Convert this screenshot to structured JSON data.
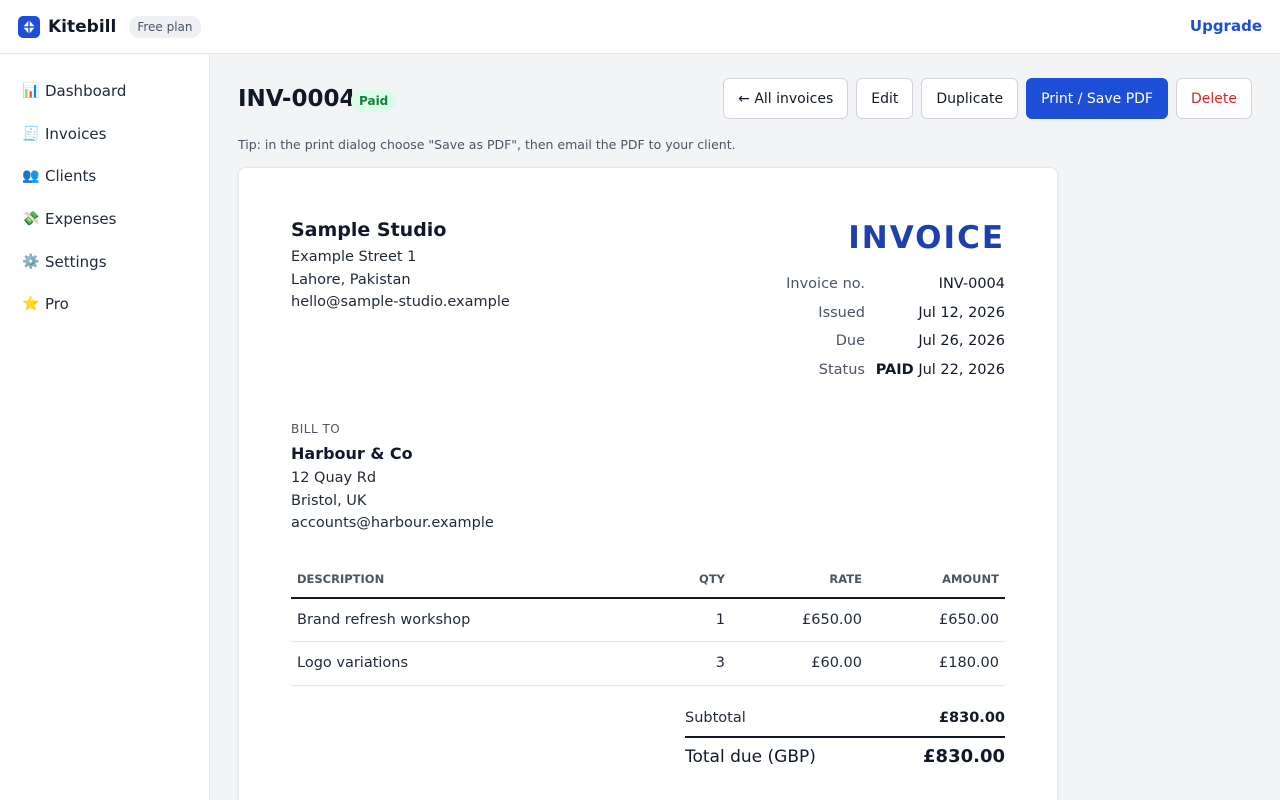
{
  "app": {
    "name": "Kitebill",
    "plan_badge": "Free plan",
    "upgrade_label": "Upgrade",
    "accent_color": "#1d4ed8"
  },
  "sidebar": {
    "items": [
      {
        "icon": "📊",
        "icon_name": "bar-chart-icon",
        "label": "Dashboard"
      },
      {
        "icon": "🧾",
        "icon_name": "receipt-icon",
        "label": "Invoices"
      },
      {
        "icon": "👥",
        "icon_name": "people-icon",
        "label": "Clients"
      },
      {
        "icon": "💸",
        "icon_name": "money-icon",
        "label": "Expenses"
      },
      {
        "icon": "⚙️",
        "icon_name": "gear-icon",
        "label": "Settings"
      },
      {
        "icon": "⭐",
        "icon_name": "star-icon",
        "label": "Pro"
      }
    ]
  },
  "header": {
    "invoice_id": "INV-0004",
    "status_badge": "Paid",
    "tip": "Tip: in the print dialog choose \"Save as PDF\", then email the PDF to your client.",
    "actions": {
      "all_invoices": "← All invoices",
      "edit": "Edit",
      "duplicate": "Duplicate",
      "print": "Print / Save PDF",
      "delete": "Delete"
    }
  },
  "invoice": {
    "from": {
      "name": "Sample Studio",
      "street": "Example Street 1",
      "city": "Lahore, Pakistan",
      "email": "hello@sample-studio.example"
    },
    "heading": "INVOICE",
    "meta": {
      "number_label": "Invoice no.",
      "number": "INV-0004",
      "issued_label": "Issued",
      "issued": "Jul 12, 2026",
      "due_label": "Due",
      "due": "Jul 26, 2026",
      "status_label": "Status",
      "status_word": "PAID",
      "status_date": "Jul 22, 2026"
    },
    "bill_to": {
      "label": "BILL TO",
      "name": "Harbour & Co",
      "street": "12 Quay Rd",
      "city": "Bristol, UK",
      "email": "accounts@harbour.example"
    },
    "columns": {
      "description": "DESCRIPTION",
      "qty": "QTY",
      "rate": "RATE",
      "amount": "AMOUNT"
    },
    "line_items": [
      {
        "description": "Brand refresh workshop",
        "qty": "1",
        "rate": "£650.00",
        "amount": "£650.00"
      },
      {
        "description": "Logo variations",
        "qty": "3",
        "rate": "£60.00",
        "amount": "£180.00"
      }
    ],
    "subtotal_label": "Subtotal",
    "subtotal": "£830.00",
    "total_label": "Total due (GBP)",
    "total": "£830.00"
  }
}
